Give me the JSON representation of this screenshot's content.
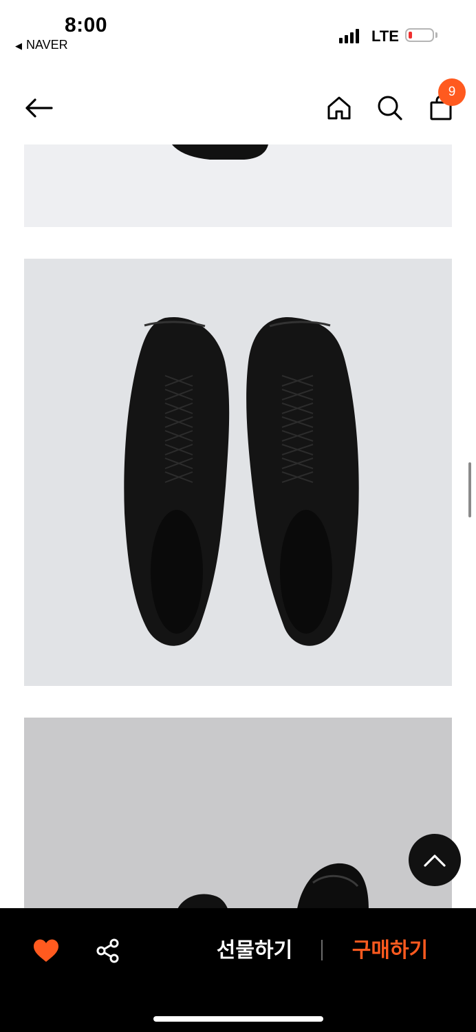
{
  "status": {
    "time": "8:00",
    "back_app": "NAVER",
    "network": "LTE"
  },
  "header": {
    "cart_count": "9"
  },
  "bottom_bar": {
    "gift_label": "선물하기",
    "buy_label": "구매하기"
  },
  "colors": {
    "accent": "#ff5a1f",
    "bar_bg": "#000000"
  },
  "icons": [
    "back-arrow-icon",
    "home-icon",
    "search-icon",
    "shopping-bag-icon",
    "heart-icon",
    "share-icon",
    "chevron-up-icon"
  ]
}
